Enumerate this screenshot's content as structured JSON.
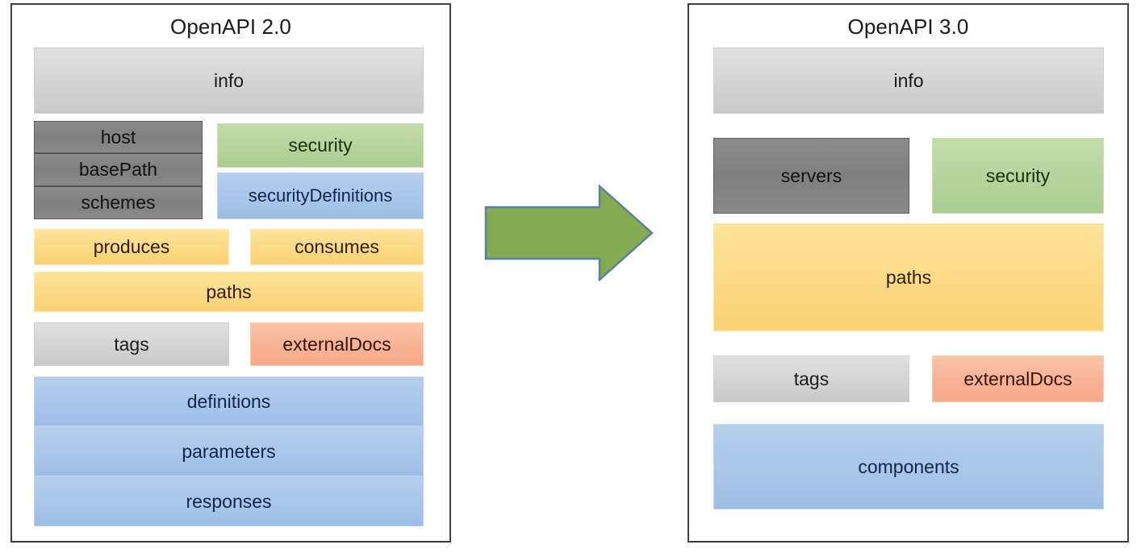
{
  "diagram": {
    "title_left": "OpenAPI 2.0",
    "title_right": "OpenAPI 3.0",
    "arrow": {
      "name": "transform-arrow",
      "direction": "right",
      "color": "#84ab52"
    }
  },
  "colors": {
    "light_gray": "#d4d4d4",
    "dark_gray": "#808080",
    "green": "#b5d49d",
    "blue": "#a9c6e8",
    "yellow": "#fcd985",
    "salmon": "#f8b295",
    "arrow_green": "#84ab52",
    "arrow_border": "#5b7fa0",
    "panel_border": "#3f3f3f"
  },
  "v2": {
    "title": "OpenAPI 2.0",
    "info": "info",
    "host": "host",
    "basePath": "basePath",
    "schemes": "schemes",
    "security": "security",
    "securityDefinitions": "securityDefinitions",
    "produces": "produces",
    "consumes": "consumes",
    "paths": "paths",
    "tags": "tags",
    "externalDocs": "externalDocs",
    "definitions": "definitions",
    "parameters": "parameters",
    "responses": "responses"
  },
  "v3": {
    "title": "OpenAPI 3.0",
    "info": "info",
    "servers": "servers",
    "security": "security",
    "paths": "paths",
    "tags": "tags",
    "externalDocs": "externalDocs",
    "components": "components"
  }
}
